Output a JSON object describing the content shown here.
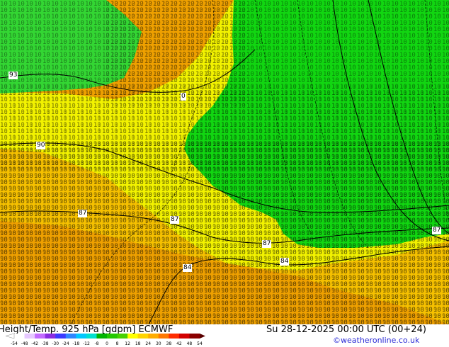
{
  "footer": {
    "title": "Height/Temp. 925 hPa [gdpm] ECMWF",
    "datetime": "Su 28-12-2025 00:00 UTC (00+24)",
    "credit": "©weatheronline.co.uk"
  },
  "colorbar": {
    "ticks": [
      "-54",
      "-48",
      "-42",
      "-38",
      "-30",
      "-24",
      "-18",
      "-12",
      "-8",
      "0",
      "8",
      "12",
      "18",
      "24",
      "30",
      "38",
      "42",
      "48",
      "54"
    ],
    "colors": [
      "#ffffff",
      "#e6c8ff",
      "#c36bff",
      "#8a2be2",
      "#3a3aff",
      "#2f86ff",
      "#00c8ff",
      "#00e0d0",
      "#00b400",
      "#23c800",
      "#47d200",
      "#ffff00",
      "#ffd400",
      "#ffad00",
      "#ff7800",
      "#ff2d00",
      "#d20000",
      "#8b0000"
    ]
  },
  "map": {
    "regions": {
      "green": "#11d611",
      "light_green": "#33d633",
      "yellow": "#f2f200",
      "light_orange": "#f5c000",
      "orange": "#eea000"
    },
    "contour_labels": [
      "93",
      "90",
      "87",
      "87",
      "87",
      "87",
      "84",
      "84",
      "0"
    ]
  }
}
